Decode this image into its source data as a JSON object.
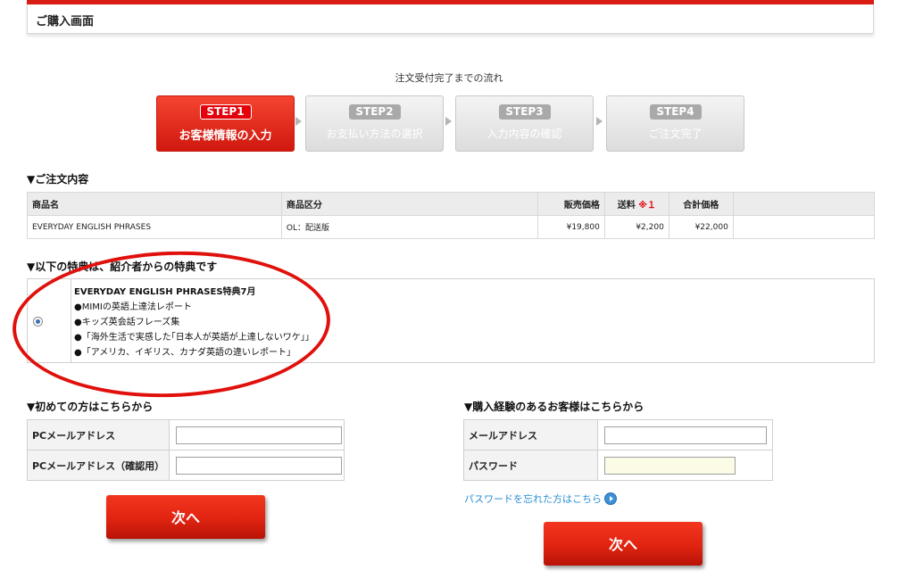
{
  "page": {
    "title": "ご購入画面"
  },
  "flow": {
    "title": "注文受付完了までの流れ",
    "steps": [
      {
        "badge": "STEP1",
        "label": "お客様情報の入力",
        "active": true
      },
      {
        "badge": "STEP2",
        "label": "お支払い方法の選択",
        "active": false
      },
      {
        "badge": "STEP3",
        "label": "入力内容の確認",
        "active": false
      },
      {
        "badge": "STEP4",
        "label": "ご注文完了",
        "active": false
      }
    ]
  },
  "order": {
    "heading": "▼ご注文内容",
    "headers": {
      "product": "商品名",
      "type": "商品区分",
      "price": "販売価格",
      "shipping": "送料",
      "shipping_mark": "※１",
      "total": "合計価格"
    },
    "row": {
      "product": "EVERYDAY ENGLISH PHRASES",
      "type": "OL：配送版",
      "price": "¥19,800",
      "shipping": "¥2,200",
      "total": "¥22,000"
    }
  },
  "bonus": {
    "heading": "▼以下の特典は、紹介者からの特典です",
    "title": "EVERYDAY ENGLISH PHRASES特典7月",
    "items": [
      "●MIMIの英語上達法レポート",
      "●キッズ英会話フレーズ集",
      "●「海外生活で実感した｢日本人が英語が上達しないワケ｣」",
      "●「アメリカ、イギリス、カナダ英語の違いレポート」"
    ]
  },
  "new_customer": {
    "heading": "▼初めての方はこちらから",
    "email_label": "PCメールアドレス",
    "email_confirm_label": "PCメールアドレス（確認用）",
    "email_value": "",
    "email_confirm_value": "",
    "next_label": "次へ"
  },
  "returning_customer": {
    "heading": "▼購入経験のあるお客様はこちらから",
    "email_label": "メールアドレス",
    "password_label": "パスワード",
    "email_value": "",
    "password_value": "",
    "forgot_label": "パスワードを忘れた方はこちら",
    "forgot_icon": "circle-arrow-right-icon",
    "next_label": "次へ"
  },
  "colors": {
    "accent": "#e3000b",
    "link": "#2a8fd4",
    "annotation": "#e0100c"
  }
}
